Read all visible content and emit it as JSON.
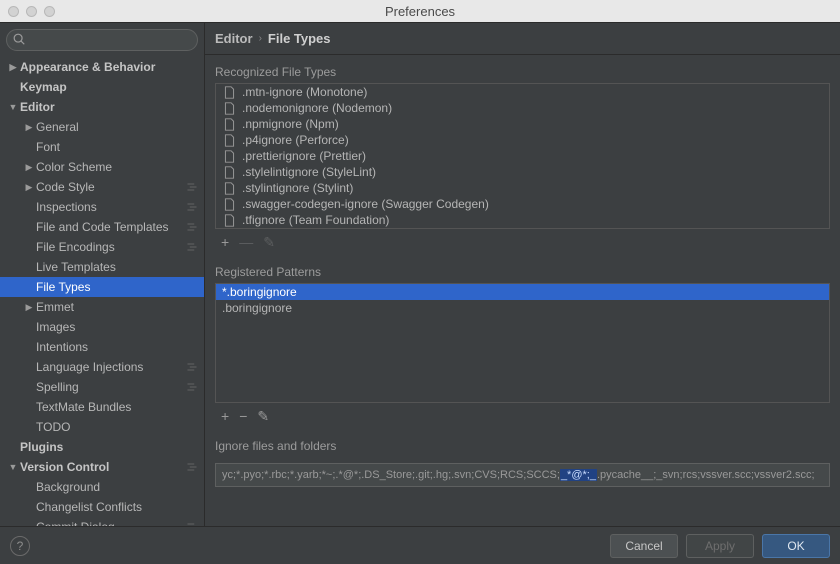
{
  "title": "Preferences",
  "search": {
    "placeholder": ""
  },
  "sidebar": {
    "items": [
      {
        "label": "Appearance & Behavior",
        "level": 0,
        "expand": "right",
        "bold": true
      },
      {
        "label": "Keymap",
        "level": 0,
        "bold": true
      },
      {
        "label": "Editor",
        "level": 0,
        "expand": "down",
        "bold": true
      },
      {
        "label": "General",
        "level": 1,
        "expand": "right"
      },
      {
        "label": "Font",
        "level": 1
      },
      {
        "label": "Color Scheme",
        "level": 1,
        "expand": "right"
      },
      {
        "label": "Code Style",
        "level": 1,
        "expand": "right",
        "settings": true
      },
      {
        "label": "Inspections",
        "level": 1,
        "settings": true
      },
      {
        "label": "File and Code Templates",
        "level": 1,
        "settings": true
      },
      {
        "label": "File Encodings",
        "level": 1,
        "settings": true
      },
      {
        "label": "Live Templates",
        "level": 1
      },
      {
        "label": "File Types",
        "level": 1,
        "selected": true
      },
      {
        "label": "Emmet",
        "level": 1,
        "expand": "right"
      },
      {
        "label": "Images",
        "level": 1
      },
      {
        "label": "Intentions",
        "level": 1
      },
      {
        "label": "Language Injections",
        "level": 1,
        "settings": true
      },
      {
        "label": "Spelling",
        "level": 1,
        "settings": true
      },
      {
        "label": "TextMate Bundles",
        "level": 1
      },
      {
        "label": "TODO",
        "level": 1
      },
      {
        "label": "Plugins",
        "level": 0,
        "bold": true
      },
      {
        "label": "Version Control",
        "level": 0,
        "expand": "down",
        "bold": true,
        "settings": true
      },
      {
        "label": "Background",
        "level": 1
      },
      {
        "label": "Changelist Conflicts",
        "level": 1
      },
      {
        "label": "Commit Dialog",
        "level": 1,
        "settings": true
      }
    ]
  },
  "breadcrumb": {
    "root": "Editor",
    "leaf": "File Types"
  },
  "recognized": {
    "label": "Recognized File Types",
    "items": [
      {
        "label": ".mtn-ignore (Monotone)"
      },
      {
        "label": ".nodemonignore (Nodemon)"
      },
      {
        "label": ".npmignore (Npm)"
      },
      {
        "label": ".p4ignore (Perforce)"
      },
      {
        "label": ".prettierignore (Prettier)"
      },
      {
        "label": ".stylelintignore (StyleLint)"
      },
      {
        "label": ".stylintignore (Stylint)"
      },
      {
        "label": ".swagger-codegen-ignore (Swagger Codegen)"
      },
      {
        "label": ".tfignore (Team Foundation)"
      }
    ],
    "buttons": {
      "add": "+",
      "minus": "—",
      "edit": "✎"
    }
  },
  "patterns": {
    "label": "Registered Patterns",
    "items": [
      {
        "label": "*.boringignore",
        "selected": true
      },
      {
        "label": ".boringignore"
      }
    ],
    "buttons": {
      "add": "+",
      "minus": "−",
      "edit": "✎"
    }
  },
  "ignore": {
    "label": "Ignore files and folders",
    "prefix": "yc;*.pyo;*.rbc;*.yarb;*~;.*@*;.DS_Store;.git;.hg;.svn;CVS;RCS;SCCS;",
    "highlight": "_*@*;_",
    "suffix": ".pycache__;_svn;rcs;vssver.scc;vssver2.scc;"
  },
  "footer": {
    "cancel": "Cancel",
    "apply": "Apply",
    "ok": "OK",
    "help": "?"
  }
}
